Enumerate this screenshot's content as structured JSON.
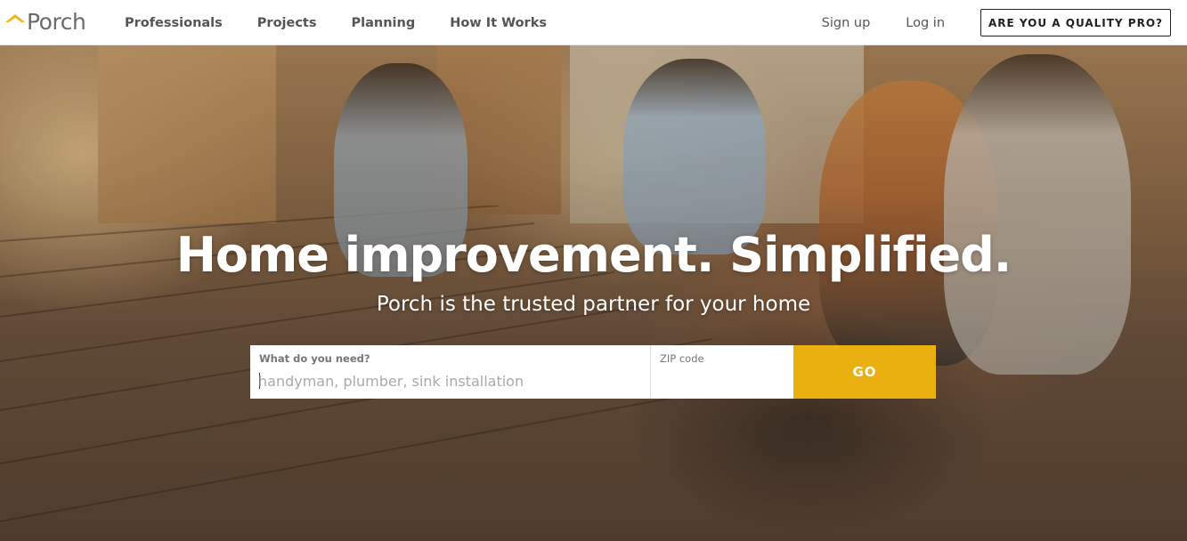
{
  "header": {
    "logo_text": "Porch",
    "logo_icon": "porch-roof-icon",
    "nav": [
      "Professionals",
      "Projects",
      "Planning",
      "How It Works"
    ],
    "signup_label": "Sign up",
    "login_label": "Log in",
    "pro_button_label": "ARE YOU A QUALITY PRO?"
  },
  "hero": {
    "headline": "Home improvement. Simplified.",
    "subheadline": "Porch is the trusted partner for your home",
    "background_description_icon": "hero-photo"
  },
  "search": {
    "need_label": "What do you need?",
    "need_placeholder": "handyman, plumber, sink installation",
    "need_value": "",
    "zip_label": "ZIP code",
    "zip_placeholder": "",
    "zip_value": "",
    "go_label": "GO"
  },
  "colors": {
    "accent": "#e9b00f",
    "logo_accent": "#f0b323",
    "text_gray": "#555555"
  }
}
